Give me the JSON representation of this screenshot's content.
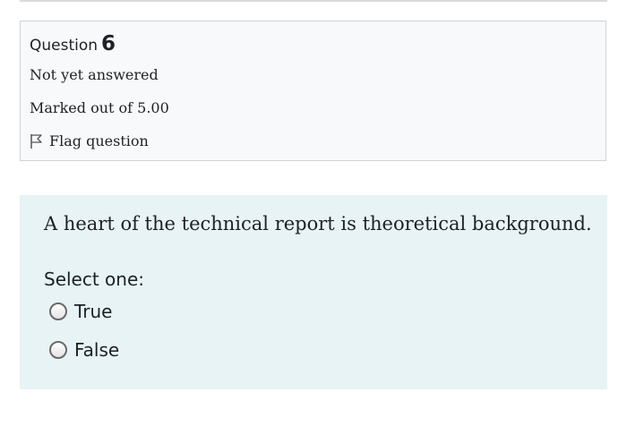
{
  "question": {
    "label": "Question",
    "number": "6",
    "state": "Not yet answered",
    "grade": "Marked out of 5.00",
    "flag_label": "Flag question",
    "flag_icon": "flag-icon"
  },
  "content": {
    "text": "A heart of the technical report is theoretical background.",
    "prompt": "Select one:",
    "options": [
      {
        "label": "True",
        "selected": false
      },
      {
        "label": "False",
        "selected": false
      }
    ]
  },
  "colors": {
    "info_bg": "#f8f9fa",
    "info_border": "#cfd3d7",
    "content_bg": "#e7f3f5",
    "text": "#1d2125"
  }
}
